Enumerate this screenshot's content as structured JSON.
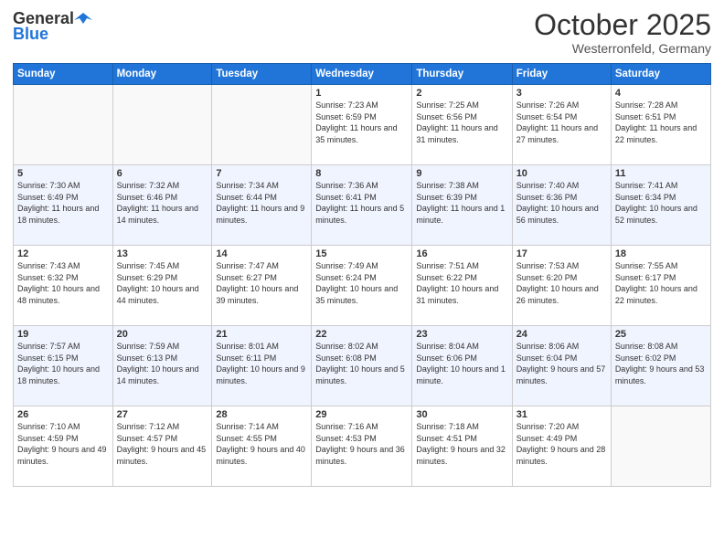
{
  "header": {
    "logo_general": "General",
    "logo_blue": "Blue",
    "month_title": "October 2025",
    "subtitle": "Westerronfeld, Germany"
  },
  "days_of_week": [
    "Sunday",
    "Monday",
    "Tuesday",
    "Wednesday",
    "Thursday",
    "Friday",
    "Saturday"
  ],
  "weeks": [
    [
      {
        "day": "",
        "info": ""
      },
      {
        "day": "",
        "info": ""
      },
      {
        "day": "",
        "info": ""
      },
      {
        "day": "1",
        "info": "Sunrise: 7:23 AM\nSunset: 6:59 PM\nDaylight: 11 hours\nand 35 minutes."
      },
      {
        "day": "2",
        "info": "Sunrise: 7:25 AM\nSunset: 6:56 PM\nDaylight: 11 hours\nand 31 minutes."
      },
      {
        "day": "3",
        "info": "Sunrise: 7:26 AM\nSunset: 6:54 PM\nDaylight: 11 hours\nand 27 minutes."
      },
      {
        "day": "4",
        "info": "Sunrise: 7:28 AM\nSunset: 6:51 PM\nDaylight: 11 hours\nand 22 minutes."
      }
    ],
    [
      {
        "day": "5",
        "info": "Sunrise: 7:30 AM\nSunset: 6:49 PM\nDaylight: 11 hours\nand 18 minutes."
      },
      {
        "day": "6",
        "info": "Sunrise: 7:32 AM\nSunset: 6:46 PM\nDaylight: 11 hours\nand 14 minutes."
      },
      {
        "day": "7",
        "info": "Sunrise: 7:34 AM\nSunset: 6:44 PM\nDaylight: 11 hours\nand 9 minutes."
      },
      {
        "day": "8",
        "info": "Sunrise: 7:36 AM\nSunset: 6:41 PM\nDaylight: 11 hours\nand 5 minutes."
      },
      {
        "day": "9",
        "info": "Sunrise: 7:38 AM\nSunset: 6:39 PM\nDaylight: 11 hours\nand 1 minute."
      },
      {
        "day": "10",
        "info": "Sunrise: 7:40 AM\nSunset: 6:36 PM\nDaylight: 10 hours\nand 56 minutes."
      },
      {
        "day": "11",
        "info": "Sunrise: 7:41 AM\nSunset: 6:34 PM\nDaylight: 10 hours\nand 52 minutes."
      }
    ],
    [
      {
        "day": "12",
        "info": "Sunrise: 7:43 AM\nSunset: 6:32 PM\nDaylight: 10 hours\nand 48 minutes."
      },
      {
        "day": "13",
        "info": "Sunrise: 7:45 AM\nSunset: 6:29 PM\nDaylight: 10 hours\nand 44 minutes."
      },
      {
        "day": "14",
        "info": "Sunrise: 7:47 AM\nSunset: 6:27 PM\nDaylight: 10 hours\nand 39 minutes."
      },
      {
        "day": "15",
        "info": "Sunrise: 7:49 AM\nSunset: 6:24 PM\nDaylight: 10 hours\nand 35 minutes."
      },
      {
        "day": "16",
        "info": "Sunrise: 7:51 AM\nSunset: 6:22 PM\nDaylight: 10 hours\nand 31 minutes."
      },
      {
        "day": "17",
        "info": "Sunrise: 7:53 AM\nSunset: 6:20 PM\nDaylight: 10 hours\nand 26 minutes."
      },
      {
        "day": "18",
        "info": "Sunrise: 7:55 AM\nSunset: 6:17 PM\nDaylight: 10 hours\nand 22 minutes."
      }
    ],
    [
      {
        "day": "19",
        "info": "Sunrise: 7:57 AM\nSunset: 6:15 PM\nDaylight: 10 hours\nand 18 minutes."
      },
      {
        "day": "20",
        "info": "Sunrise: 7:59 AM\nSunset: 6:13 PM\nDaylight: 10 hours\nand 14 minutes."
      },
      {
        "day": "21",
        "info": "Sunrise: 8:01 AM\nSunset: 6:11 PM\nDaylight: 10 hours\nand 9 minutes."
      },
      {
        "day": "22",
        "info": "Sunrise: 8:02 AM\nSunset: 6:08 PM\nDaylight: 10 hours\nand 5 minutes."
      },
      {
        "day": "23",
        "info": "Sunrise: 8:04 AM\nSunset: 6:06 PM\nDaylight: 10 hours\nand 1 minute."
      },
      {
        "day": "24",
        "info": "Sunrise: 8:06 AM\nSunset: 6:04 PM\nDaylight: 9 hours\nand 57 minutes."
      },
      {
        "day": "25",
        "info": "Sunrise: 8:08 AM\nSunset: 6:02 PM\nDaylight: 9 hours\nand 53 minutes."
      }
    ],
    [
      {
        "day": "26",
        "info": "Sunrise: 7:10 AM\nSunset: 4:59 PM\nDaylight: 9 hours\nand 49 minutes."
      },
      {
        "day": "27",
        "info": "Sunrise: 7:12 AM\nSunset: 4:57 PM\nDaylight: 9 hours\nand 45 minutes."
      },
      {
        "day": "28",
        "info": "Sunrise: 7:14 AM\nSunset: 4:55 PM\nDaylight: 9 hours\nand 40 minutes."
      },
      {
        "day": "29",
        "info": "Sunrise: 7:16 AM\nSunset: 4:53 PM\nDaylight: 9 hours\nand 36 minutes."
      },
      {
        "day": "30",
        "info": "Sunrise: 7:18 AM\nSunset: 4:51 PM\nDaylight: 9 hours\nand 32 minutes."
      },
      {
        "day": "31",
        "info": "Sunrise: 7:20 AM\nSunset: 4:49 PM\nDaylight: 9 hours\nand 28 minutes."
      },
      {
        "day": "",
        "info": ""
      }
    ]
  ]
}
